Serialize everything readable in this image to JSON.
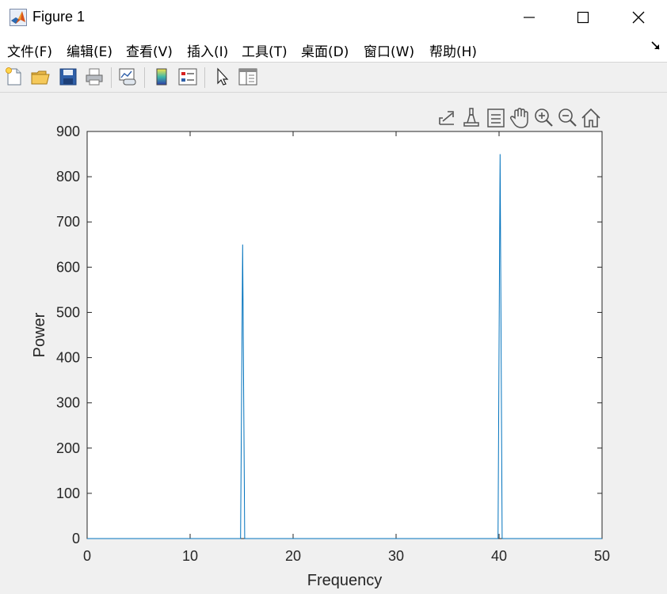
{
  "window": {
    "title": "Figure 1"
  },
  "menu": {
    "items": [
      "文件(F)",
      "编辑(E)",
      "查看(V)",
      "插入(I)",
      "工具(T)",
      "桌面(D)",
      "窗口(W)",
      "帮助(H)"
    ]
  },
  "toolbar": {
    "buttons": [
      "new-figure-icon",
      "open-file-icon",
      "save-icon",
      "print-icon",
      "link-plot-icon",
      "insert-colorbar-icon",
      "insert-legend-icon",
      "edit-plot-icon",
      "property-inspector-icon"
    ]
  },
  "axes_toolbar": {
    "buttons": [
      "export-icon",
      "brush-icon",
      "data-tips-icon",
      "pan-icon",
      "zoom-in-icon",
      "zoom-out-icon",
      "home-icon"
    ]
  },
  "colors": {
    "line": "#0072bd",
    "background": "#f0f0f0",
    "axes": "#ffffff"
  },
  "chart_data": {
    "type": "line",
    "title": "",
    "xlabel": "Frequency",
    "ylabel": "Power",
    "xlim": [
      0,
      50
    ],
    "ylim": [
      0,
      900
    ],
    "xticks": [
      0,
      10,
      20,
      30,
      40,
      50
    ],
    "yticks": [
      0,
      100,
      200,
      300,
      400,
      500,
      600,
      700,
      800,
      900
    ],
    "grid": false,
    "series": [
      {
        "x": [
          0,
          14.9,
          15.1,
          15.3,
          39.9,
          40.1,
          40.3,
          50
        ],
        "y": [
          0,
          0,
          650,
          0,
          0,
          850,
          0,
          0
        ]
      }
    ]
  }
}
